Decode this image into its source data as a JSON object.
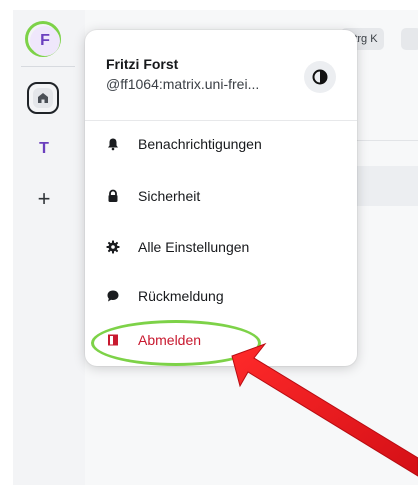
{
  "rail": {
    "user_avatar_letter": "F",
    "space_letter": "T",
    "add_space_symbol": "+"
  },
  "header": {
    "search_shortcut": "Strg K"
  },
  "menu": {
    "profile_name": "Fritzi Forst",
    "profile_id": "@ff1064:matrix.uni-frei...",
    "items": [
      {
        "label": "Benachrichtigungen",
        "icon": "bell-icon"
      },
      {
        "label": "Sicherheit",
        "icon": "lock-icon"
      },
      {
        "label": "Alle Einstellungen",
        "icon": "gear-icon"
      },
      {
        "label": "Rückmeldung",
        "icon": "chat-bubble-icon"
      },
      {
        "label": "Abmelden",
        "icon": "sign-out-icon"
      }
    ]
  },
  "colors": {
    "accent_purple": "#6b3fbe",
    "highlight_green": "#7dd248",
    "danger_red": "#c8192f",
    "arrow_red": "#e8141b"
  }
}
